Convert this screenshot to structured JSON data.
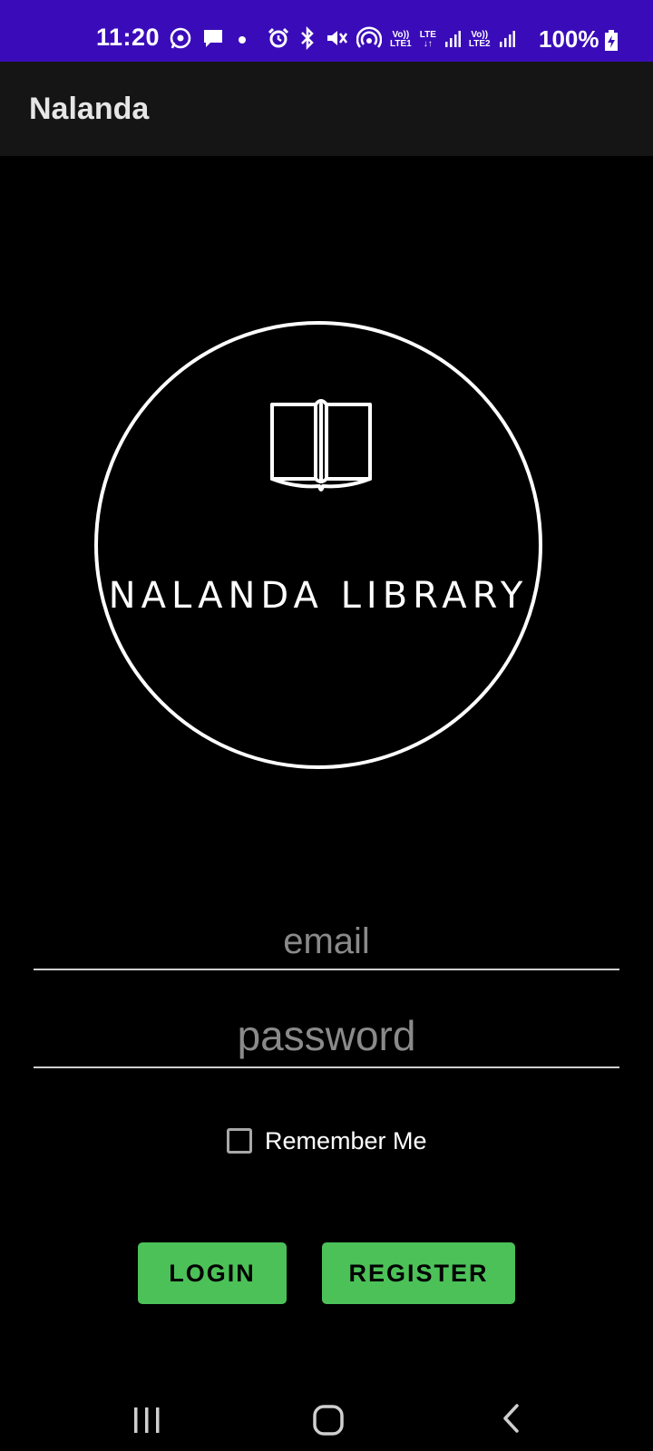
{
  "status_bar": {
    "time": "11:20",
    "lte1_top": "Vo))",
    "lte1_bottom": "LTE1",
    "lte_top": "LTE",
    "lte_bottom": "↓↑",
    "lte2_top": "Vo))",
    "lte2_bottom": "LTE2",
    "battery": "100%",
    "background_color": "#3a0cb9",
    "icons": [
      "whatsapp-icon",
      "message-icon",
      "dot-icon",
      "alarm-icon",
      "bluetooth-icon",
      "mute-vibrate-icon",
      "hotspot-icon",
      "signal-icon",
      "signal-icon",
      "battery-charging-icon"
    ]
  },
  "app_bar": {
    "title": "Nalanda"
  },
  "logo": {
    "text": "NALANDA LIBRARY",
    "icon": "open-book-icon"
  },
  "form": {
    "email_placeholder": "email",
    "email_value": "",
    "password_placeholder": "password",
    "password_value": "",
    "remember_label": "Remember Me",
    "remember_checked": false
  },
  "buttons": {
    "login_label": "LOGIN",
    "register_label": "REGISTER",
    "color": "#4cc158"
  },
  "nav_bar": {
    "icons": [
      "recents-icon",
      "home-icon",
      "back-icon"
    ]
  }
}
